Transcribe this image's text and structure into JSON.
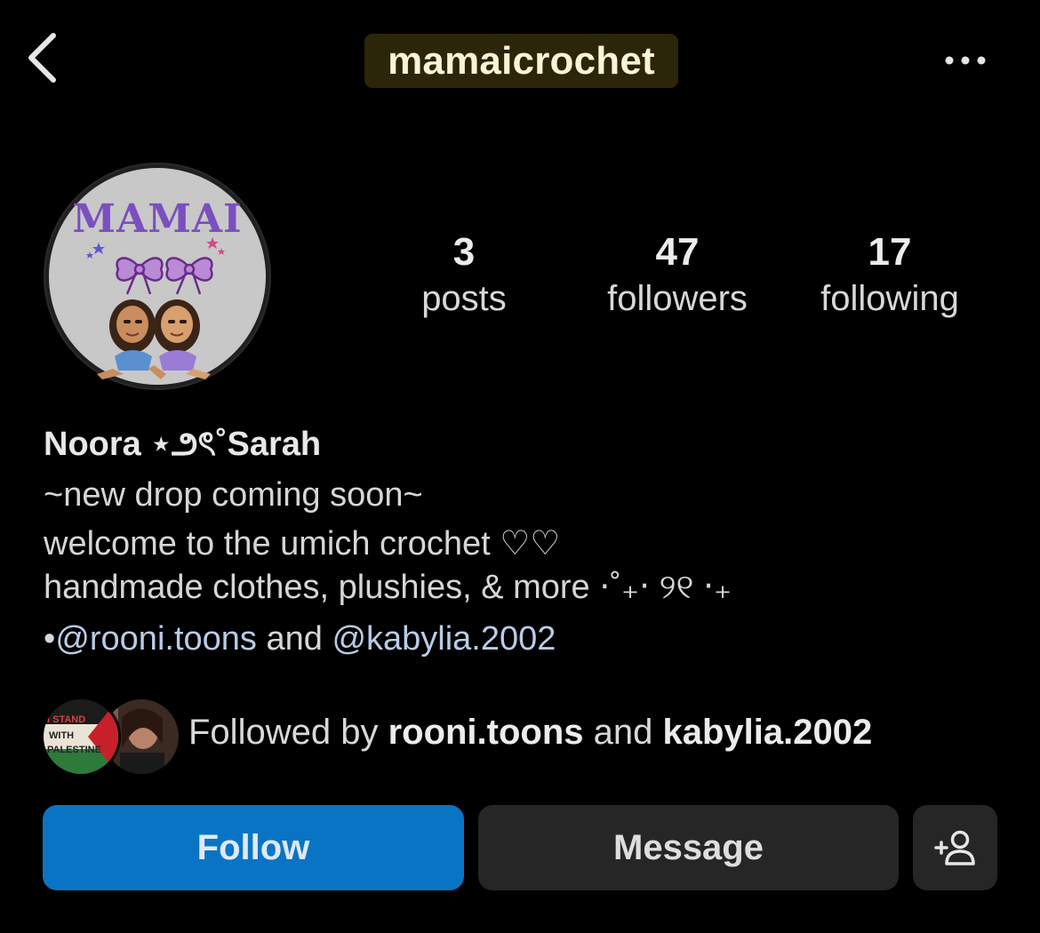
{
  "header": {
    "username": "mamaicrochet",
    "back_icon": "chevron-left-icon",
    "more_icon": "more-horizontal-icon"
  },
  "avatar": {
    "logo_text": "MAMAI"
  },
  "stats": {
    "posts": {
      "count": "3",
      "label": "posts"
    },
    "followers": {
      "count": "47",
      "label": "followers"
    },
    "following": {
      "count": "17",
      "label": "following"
    }
  },
  "bio": {
    "display_name": "Noora ⋆౨ৎ˚Sarah",
    "line1": "~new drop coming soon~",
    "line2": "welcome to the umich crochet ♡♡",
    "line3": "handmade clothes, plushies, & more ⋅˚₊‧ ୨୧ ‧₊",
    "bullet": "•",
    "mention1": "@rooni.toons",
    "and_text": " and ",
    "mention2": "@kabylia.2002"
  },
  "followed_by": {
    "prefix": "Followed by ",
    "user1": "rooni.toons",
    "and_text": " and ",
    "user2": "kabylia.2002",
    "badge_text": "I STAND WITH PALESTINE"
  },
  "actions": {
    "follow_label": "Follow",
    "message_label": "Message",
    "add_user_icon": "add-person-icon"
  },
  "colors": {
    "background": "#000000",
    "follow_button": "#0a74c4",
    "secondary_button": "#262626",
    "mention": "#b9cce6",
    "title_highlight": "#2b2509"
  }
}
